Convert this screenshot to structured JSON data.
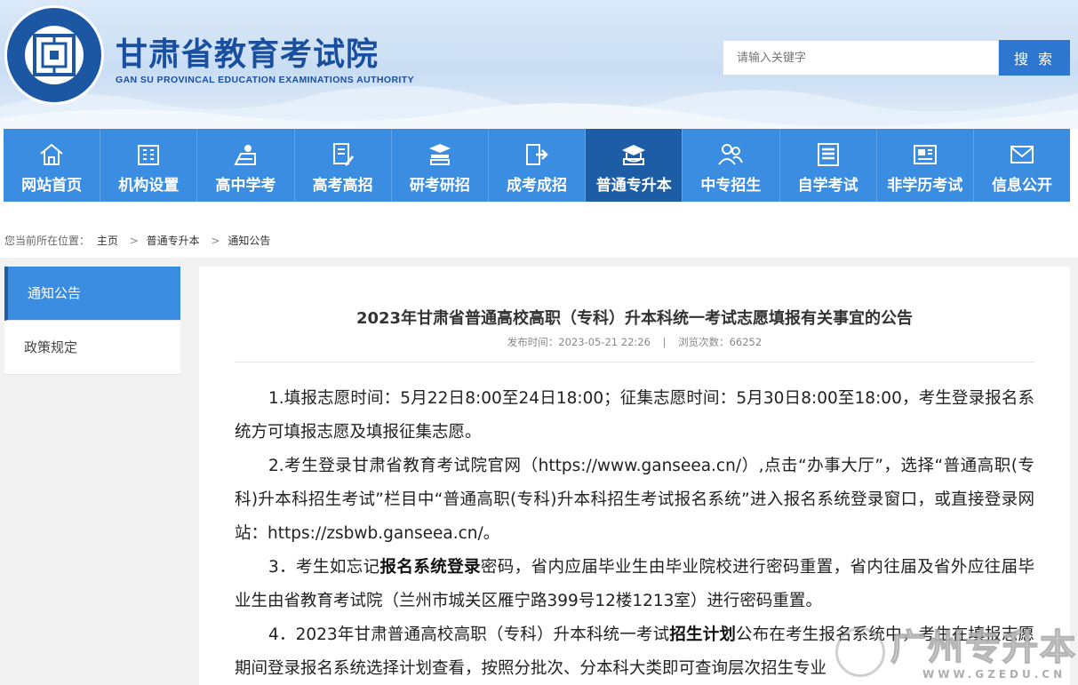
{
  "header": {
    "site_name": "甘肃省教育考试院",
    "site_name_en": "GAN SU PROVINCAL EDUCATION EXAMINATIONS AUTHORITY",
    "search_placeholder": "请输入关键字",
    "search_button": "搜 索"
  },
  "nav": [
    {
      "label": "网站首页",
      "icon": "home-icon"
    },
    {
      "label": "机构设置",
      "icon": "building-icon"
    },
    {
      "label": "高中学考",
      "icon": "student-icon"
    },
    {
      "label": "高考高招",
      "icon": "document-pen-icon"
    },
    {
      "label": "研考研招",
      "icon": "books-icon"
    },
    {
      "label": "成考成招",
      "icon": "book-arrow-icon"
    },
    {
      "label": "普通专升本",
      "icon": "graduation-cap-icon",
      "active": true
    },
    {
      "label": "中专招生",
      "icon": "people-icon"
    },
    {
      "label": "自学考试",
      "icon": "notepad-icon"
    },
    {
      "label": "非学历考试",
      "icon": "id-card-icon"
    },
    {
      "label": "信息公开",
      "icon": "mail-icon"
    }
  ],
  "breadcrumb": {
    "prefix": "您当前所在位置：",
    "items": [
      "主页",
      "普通专升本",
      "通知公告"
    ],
    "separator": ">"
  },
  "sidebar": {
    "items": [
      {
        "label": "通知公告",
        "active": true
      },
      {
        "label": "政策规定",
        "active": false
      }
    ]
  },
  "article": {
    "title": "2023年甘肃省普通高校高职（专科）升本科统一考试志愿填报有关事宜的公告",
    "publish_label": "发布时间：",
    "publish_time": "2023-05-21 22:26",
    "views_label": "浏览次数：",
    "views": "66252",
    "p1": "1.填报志愿时间：5月22日8:00至24日18:00；征集志愿时间：5月30日8:00至18:00，考生登录报名系统方可填报志愿及填报征集志愿。",
    "p2": "2.考生登录甘肃省教育考试院官网（https://www.ganseea.cn/）,点击“办事大厅”，选择“普通高职(专科)升本科招生考试”栏目中“普通高职(专科)升本科招生考试报名系统”进入报名系统登录窗口，或直接登录网站：https://zsbwb.ganseea.cn/。",
    "p3_a": "3．考生如忘记",
    "p3_bold": "报名系统登录",
    "p3_b": "密码，省内应届毕业生由毕业院校进行密码重置，省内往届及省外应往届毕业生由省教育考试院（兰州市城关区雁宁路399号12楼1213室）进行密码重置。",
    "p4_a": "4．2023年甘肃普通高校高职（专科）升本科统一考试",
    "p4_bold": "招生计划",
    "p4_b": "公布在考生报名系统中，考生在填报志愿期间登录报名系统选择计划查看，按照分批次、分本科大类即可查询层次招生专业"
  },
  "watermark": {
    "text": "广州专升本",
    "sub": "WWW.GZEDU.CN"
  }
}
